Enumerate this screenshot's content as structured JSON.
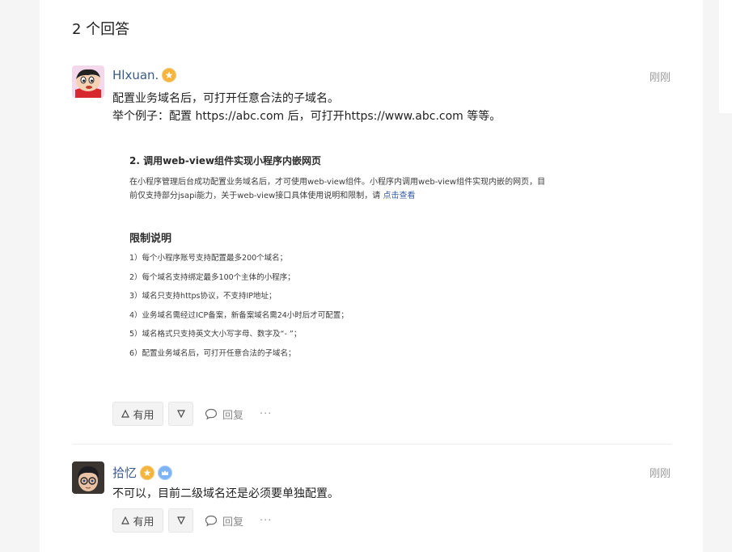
{
  "section_title": "2 个回答",
  "answers": [
    {
      "author": "Hlxuan.",
      "time": "刚刚",
      "text_lines": [
        "配置业务域名后，可打开任意合法的子域名。",
        "举个例子：配置 https://abc.com 后，可打开https://www.abc.com 等等。"
      ],
      "doc_image": {
        "heading": "2. 调用web-view组件实现小程序内嵌网页",
        "para_line1": "在小程序管理后台成功配置业务域名后，才可使用web-view组件。小程序内调用web-view组件实现内嵌的网页，目",
        "para_line2": "前仅支持部分jsapi能力，关于web-view接口具体使用说明和限制，请 ",
        "para_link": "点击查看",
        "subheading": "限制说明",
        "limits": [
          "1）每个小程序账号支持配置最多200个域名；",
          "2）每个域名支持绑定最多100个主体的小程序；",
          "3）域名只支持https协议，不支持IP地址；",
          "4）业务域名需经过ICP备案，新备案域名需24小时后才可配置；",
          "5）域名格式只支持英文大小写字母、数字及“- ”；",
          "6）配置业务域名后，可打开任意合法的子域名；"
        ]
      },
      "actions": {
        "useful": "有用",
        "reply": "回复",
        "more": "···"
      }
    },
    {
      "author": "拾忆",
      "time": "刚刚",
      "text": "不可以，目前二级域名还是必须要单独配置。",
      "actions": {
        "useful": "有用",
        "reply": "回复",
        "more": "···"
      }
    }
  ]
}
